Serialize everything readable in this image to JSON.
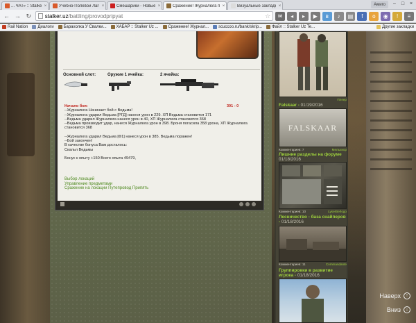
{
  "browser": {
    "tabs": [
      {
        "title": "... ЧАТ» :: Stalker Uz Террит...",
        "color": "#d95a2b"
      },
      {
        "title": "Учебно-Полевой Лагерь",
        "color": "#d95a2b"
      },
      {
        "title": "Смешарики - Новые приклю...",
        "color": "#cc1f1f"
      },
      {
        "title": "Сражение! Журналюга пр...",
        "color": "#8b6b3a"
      },
      {
        "title": "Визуальные закладки",
        "color": "#dcdcdc"
      }
    ],
    "user_name": "Амиго",
    "url_host": "stalker.uz",
    "url_path": "/battling/provodpripyat",
    "bookmarks": [
      {
        "label": "Rail Nation",
        "color": "#c23a1e"
      },
      {
        "label": "Диалоги",
        "color": "#7a8fb8"
      },
      {
        "label": "Барахолка У Свалки...",
        "color": "#8b6b3a"
      },
      {
        "label": "ХАБАР :: Stalker Uz ...",
        "color": "#8b6b3a"
      },
      {
        "label": "Сражение! Журнал...",
        "color": "#8b6b3a"
      },
      {
        "label": "scuccoo.ru/bank/skrip...",
        "color": "#5a7db8"
      },
      {
        "label": "Файл :: Stalker Uz Te...",
        "color": "#8b6b3a"
      }
    ],
    "bookmarks_other": "Другие закладки"
  },
  "battle": {
    "main_slot_label": "Основной слот:",
    "weapon1_label": "Оружие 1 ячейка:",
    "weapon2_label": "2 ячейка:",
    "round_label": "301 - 0",
    "log": [
      {
        "text": "Начало боя:",
        "red": true
      },
      {
        "text": "--Журналюга Начинает бой с Ведьма!",
        "red": false
      },
      {
        "text": "--Журналюга ударил Ведьма [РГД] нанеся урон в 229. ХП Ведьма становится 171",
        "red": false
      },
      {
        "text": "--Ведьма ударил Журналюга нанеся урон в 40, ХП Журналюга становится 368",
        "red": false
      },
      {
        "text": "--Ведьма производит удар, нанеся Журналюга урон в 398. Броня погасила 358 урона, ХП Журналюга становится 368",
        "red": false
      },
      {
        "text": "",
        "red": false
      },
      {
        "text": "--Журналюга ударил Ведьма [Ф1] нанеся урон в 385. Ведьма поражен!",
        "red": false
      },
      {
        "text": "--Бой закончен!",
        "red": false
      },
      {
        "text": "В качестве бонуса Вам досталось:",
        "red": false
      },
      {
        "text": "Скальп Ведьмы",
        "red": false
      },
      {
        "text": "",
        "red": false
      },
      {
        "text": "Бонус к опыту +150 Всего опыта 49479,",
        "red": false
      }
    ],
    "links": [
      "Выбор локаций",
      "Управление предметами",
      "Сражение на локации Путепровод Припять"
    ]
  },
  "sidebar": {
    "posts": [
      {
        "title": "Falskaar",
        "date": "01/19/2016",
        "banner": "FALSKAAR",
        "meta_left": "Комментариев: 7",
        "author": "Мельхиор"
      },
      {
        "title": "Лишние разделы на форуме",
        "date": "01/18/2016",
        "banner": "",
        "meta_left": "Комментариев: 10",
        "author": "LyserBerlogo"
      },
      {
        "title": "Лесничество - база снайперов",
        "date": "01/18/2016",
        "banner": "",
        "meta_left": "Комментариев: 11",
        "author": "Commandante"
      },
      {
        "title": "Группировки в развитие игрока",
        "date": "01/18/2016",
        "banner": "",
        "meta_left": "",
        "author": ""
      }
    ],
    "top_author": "Плеер"
  },
  "scroll": {
    "up_label": "Наверх",
    "down_label": "Вниз"
  }
}
